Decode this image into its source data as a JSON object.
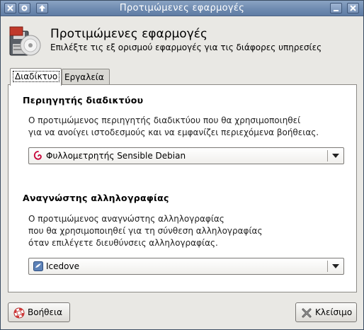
{
  "window": {
    "title": "Προτιμώμενες εφαρμογές"
  },
  "header": {
    "title": "Προτιμώμενες εφαρμογές",
    "subtitle": "Επιλέξτε τις εξ ορισμού εφαρμογές για τις διάφορες υπηρεσίες"
  },
  "tabs": [
    {
      "label": "Διαδίκτυο",
      "active": true
    },
    {
      "label": "Εργαλεία",
      "active": false
    }
  ],
  "browser_section": {
    "title": "Περιηγητής διαδικτύου",
    "desc_line1": "Ο προτιμώμενος περιηγητής διαδικτύου που θα χρησιμοποιηθεί",
    "desc_line2": "για να ανοίγει ιστοδεσμούς και να εμφανίζει περιεχόμενα βοήθειας.",
    "selected": "Φυλλομετρητής Sensible Debian",
    "icon": "debian-swirl-icon"
  },
  "mail_section": {
    "title": "Αναγνώστης αλληλογραφίας",
    "desc_line1": "Ο προτιμώμενος αναγνώστης αλληλογραφίας",
    "desc_line2": "που θα χρησιμοποιηθεί για τη σύνθεση αλληλογραφίας",
    "desc_line3": "όταν επιλέγετε διευθύνσεις αλληλογραφίας.",
    "selected": "Icedove",
    "icon": "icedove-icon"
  },
  "buttons": {
    "help_label": "Βοήθεια",
    "close_label": "Κλείσιμο"
  },
  "colors": {
    "titlebar": "#6f8bb1",
    "panel_bg": "#ffffff",
    "window_bg": "#e9e8e4",
    "debian_red": "#c70036"
  }
}
